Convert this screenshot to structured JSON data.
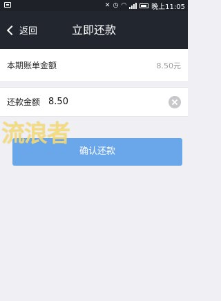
{
  "status_bar": {
    "time": "晚上11:05",
    "icons": [
      "notification-icon",
      "mute-icon",
      "alarm-icon",
      "wifi-icon",
      "signal-icon",
      "battery-icon"
    ]
  },
  "nav": {
    "back_label": "返回",
    "title": "立即还款"
  },
  "bill": {
    "label": "本期账单金额",
    "value": "8.50元"
  },
  "payment": {
    "label": "还款金额",
    "value": "8.50"
  },
  "confirm_button": {
    "label": "确认还款",
    "color": "#6aa6ea"
  },
  "watermark": {
    "text": "流浪者"
  },
  "colors": {
    "nav_background": "#22262f",
    "page_background": "#efeff4"
  }
}
